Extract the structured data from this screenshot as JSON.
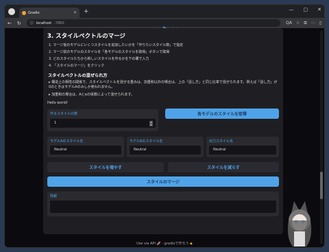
{
  "browser": {
    "tab_title": "Gradio",
    "url_host": "localhost",
    "url_port": ":7860",
    "zoom": "QA"
  },
  "section": {
    "title": "3. スタイルベクトルのマージ",
    "steps": [
      "1. マージ後のモデルにいくつスタイルを追加したいかを「作りたいスタイル数」で指定",
      "2. マージ前のモデルのスタイルを「各モデルのスタイルを取得」ボタンで取得",
      "3. どのスタイルたちから新しいスタイルを作るかを下の欄で入力",
      "4. 「スタイルのマージ」をクリック"
    ],
    "subheading": "スタイルベクトルの混ぜられ方",
    "bullets": [
      "構造上の相性の関係で、スタイルベクトルを混ぜる重みは、加重和以外の場合は、上の「話し方」と同じ比率で混ぜられます。例えば「話し方」が0のときはモデルAのみしか使われません。",
      "加重和の場合は、Aとαの係数によって混ぜられます。"
    ],
    "hello": "Hello world!"
  },
  "form": {
    "num_styles_label": "作るスタイルの数",
    "num_styles_value": "1",
    "get_styles_button": "各モデルのスタイルを取得",
    "model_a_label": "モデルAのスタイル名",
    "model_a_value": "Neutral",
    "model_b_label": "モデルBのスタイル名",
    "model_b_value": "Neutral",
    "output_label": "出力スタイル名",
    "output_value": "Neutral",
    "add_style_button": "スタイルを増やす",
    "remove_style_button": "スタイルを減らす",
    "merge_button": "スタイルのマージ",
    "info_label": "情報"
  },
  "footer": {
    "api": "Use via API",
    "sep": "·",
    "gradio": "gradioで作ろう"
  },
  "colors": {
    "accent": "#4fa3e8",
    "panel": "#1f1f23",
    "background": "#0b0b0f"
  }
}
